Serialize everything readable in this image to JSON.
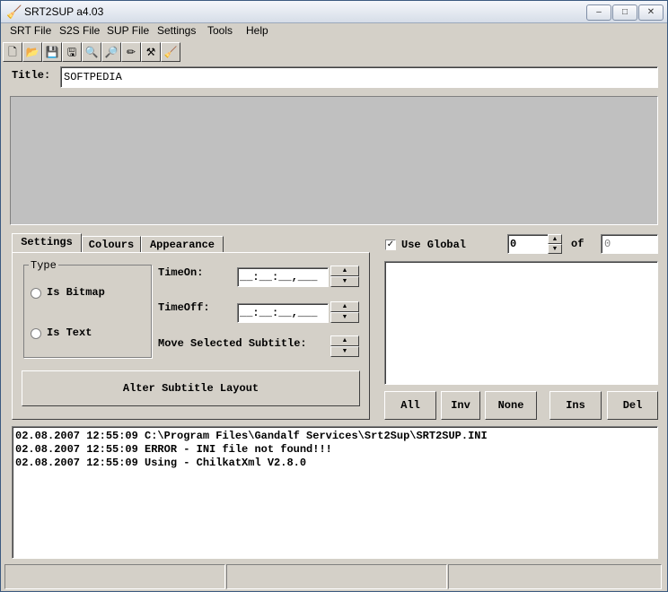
{
  "window": {
    "title": "SRT2SUP a4.03"
  },
  "menu": [
    "SRT File",
    "S2S File",
    "SUP File",
    "Settings",
    "Tools",
    "Help"
  ],
  "toolbar": {
    "icons": [
      "new-file-icon",
      "open-folder-icon",
      "save-icon",
      "save-as-icon",
      "binoculars-icon",
      "find-icon",
      "pencil-icon",
      "hammer-icon",
      "broom-icon"
    ]
  },
  "title_field": {
    "label": "Title:",
    "value": "SOFTPEDIA"
  },
  "tabs": [
    "Settings",
    "Colours",
    "Appearance"
  ],
  "settings": {
    "type_group": "Type",
    "is_bitmap": "Is Bitmap",
    "is_text": "Is Text",
    "time_on_label": "TimeOn:",
    "time_on_value": "__:__:__,___",
    "time_off_label": "TimeOff:",
    "time_off_value": "__:__:__,___",
    "move_label": "Move Selected Subtitle:",
    "alter_button": "Alter Subtitle Layout"
  },
  "global": {
    "use_global_label": "Use Global",
    "checked": true,
    "index_value": "0",
    "of_label": "of",
    "total_value": "0"
  },
  "list_buttons": [
    "All",
    "Inv",
    "None",
    "Ins",
    "Del"
  ],
  "log": [
    "02.08.2007 12:55:09 C:\\Program Files\\Gandalf Services\\Srt2Sup\\SRT2SUP.INI",
    "02.08.2007 12:55:09 ERROR - INI file not found!!!",
    "02.08.2007 12:55:09 Using - ChilkatXml V2.8.0"
  ]
}
